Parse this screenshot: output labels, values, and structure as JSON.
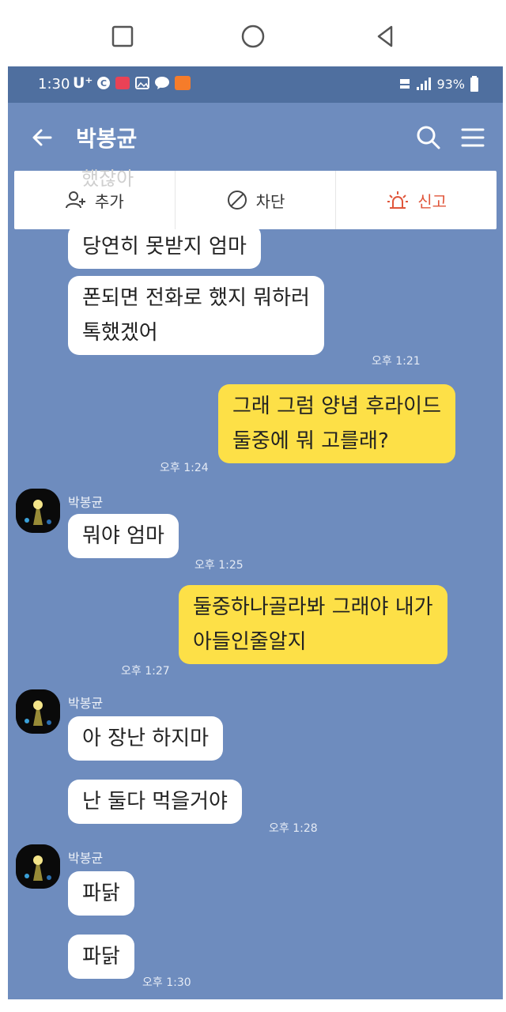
{
  "system_nav": {
    "recent_icon": "square-recent-apps-icon",
    "home_icon": "circle-home-icon",
    "back_icon": "triangle-back-icon"
  },
  "status_bar": {
    "time": "1:30",
    "carrier": "U⁺",
    "battery": "93%"
  },
  "header": {
    "title": "박봉균",
    "back_icon": "arrow-left-icon",
    "search_icon": "search-icon",
    "menu_icon": "menu-icon"
  },
  "actions": {
    "add": "추가",
    "block": "차단",
    "report": "신고",
    "ghost": "했잖아"
  },
  "messages": [
    {
      "id": "m1",
      "from": "other",
      "lines": [
        "당연히 못받지 엄마"
      ],
      "time": ""
    },
    {
      "id": "m2",
      "from": "other",
      "lines": [
        "폰되면 전화로 했지 뭐하러",
        "톡했겠어"
      ],
      "time": "오후 1:21"
    },
    {
      "id": "m3",
      "from": "me",
      "lines": [
        "그래 그럼 양념 후라이드",
        "둘중에 뭐 고를래?"
      ],
      "time": "오후 1:24"
    },
    {
      "id": "m4",
      "from": "other",
      "sender": "박봉균",
      "lines": [
        "뭐야 엄마"
      ],
      "time": "오후 1:25"
    },
    {
      "id": "m5",
      "from": "me",
      "lines": [
        "둘중하나골라봐 그래야 내가",
        "아들인줄알지"
      ],
      "time": "오후 1:27"
    },
    {
      "id": "m6",
      "from": "other",
      "sender": "박봉균",
      "lines": [
        "아 장난 하지마"
      ],
      "time": ""
    },
    {
      "id": "m7",
      "from": "other",
      "lines": [
        "난 둘다 먹을거야"
      ],
      "time": "오후 1:28"
    },
    {
      "id": "m8",
      "from": "other",
      "sender": "박봉균",
      "lines": [
        "파닭"
      ],
      "time": ""
    },
    {
      "id": "m9",
      "from": "other",
      "lines": [
        "파닭"
      ],
      "time": "오후 1:30"
    }
  ],
  "colors": {
    "chat_bg": "#6e8cbe",
    "my_bubble": "#fde047",
    "their_bubble": "#ffffff",
    "report": "#e0563b"
  }
}
